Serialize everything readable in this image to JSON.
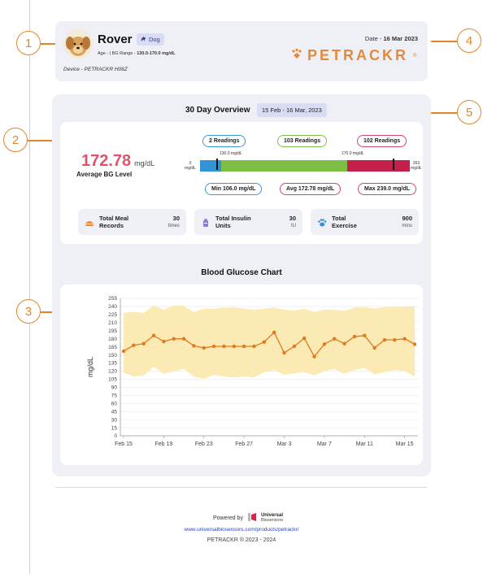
{
  "callouts": [
    "1",
    "2",
    "3",
    "4",
    "5"
  ],
  "header": {
    "pet_name": "Rover",
    "species": "Dog",
    "age_label": "Age -",
    "bg_range_label": "| BG Range -",
    "bg_range_value": "130.0-170.0 mg/dL",
    "device": "Device - PETRACKR H06Z",
    "date_label": "Date -",
    "date_value": "16 Mar 2023",
    "brand": "PETRACKR",
    "brand_reg": "®"
  },
  "overview": {
    "title": "30 Day Overview",
    "date_range": "15 Feb - 16 Mar, 2023",
    "avg_value": "172.78",
    "avg_unit": "mg/dL",
    "avg_label": "Average BG Level",
    "readings": {
      "low": "2 Readings",
      "in_range": "103 Readings",
      "high": "102 Readings"
    },
    "bar_labels": {
      "min": "0",
      "min_unit": "mg/dL",
      "low_threshold": "130.0 mg/dL",
      "high_threshold": "170.0 mg/dL",
      "max": "263",
      "max_unit": "mg/dL"
    },
    "range_fractions": {
      "low": 0.1,
      "in_range": 0.6,
      "high": 0.3
    },
    "markers_mgdl": [
      106.0,
      239.0
    ],
    "stats_pills": {
      "min": "Min 106.0 mg/dL",
      "avg": "Avg 172.78 mg/dL",
      "max": "Max 239.0 mg/dL"
    },
    "tiles": [
      {
        "label_line1": "Total Meal",
        "label_line2": "Records",
        "value": "30",
        "unit": "times",
        "icon": "meal-icon",
        "color": "#f08a3a"
      },
      {
        "label_line1": "Total Insulin",
        "label_line2": "Units",
        "value": "30",
        "unit": "IU",
        "icon": "insulin-icon",
        "color": "#8d7ae0"
      },
      {
        "label_line1": "Total",
        "label_line2": "Exercise",
        "value": "900",
        "unit": "mins",
        "icon": "paw-icon",
        "color": "#2f93d6"
      }
    ]
  },
  "colors": {
    "accent": "#e0862a",
    "avg": "#e0536a",
    "low": "#2f93d6",
    "in_range": "#7fbe44",
    "high": "#c41e4a",
    "band": "#fbeab4",
    "line": "#e07a1c"
  },
  "chart_data": {
    "type": "line",
    "title": "Blood Glucose Chart",
    "xlabel": "",
    "ylabel": "mg/dL",
    "ylim": [
      0,
      255
    ],
    "yticks": [
      0,
      15,
      30,
      45,
      60,
      75,
      90,
      105,
      120,
      135,
      150,
      165,
      180,
      195,
      210,
      225,
      240,
      255
    ],
    "x_tick_labels": [
      "Feb 15",
      "Feb 19",
      "Feb 23",
      "Feb 27",
      "Mar 3",
      "Mar 7",
      "Mar 11",
      "Mar 15"
    ],
    "x_tick_days": [
      0,
      4,
      8,
      12,
      16,
      20,
      24,
      28
    ],
    "grid": true,
    "series": [
      {
        "values": [
          157,
          168,
          171,
          186,
          175,
          180,
          180,
          167,
          163,
          166,
          166,
          166,
          166,
          166,
          174,
          192,
          154,
          166,
          181,
          147,
          170,
          180,
          171,
          184,
          186,
          163,
          178,
          178,
          180,
          170
        ]
      }
    ],
    "band_upper": [
      228,
      230,
      228,
      242,
      234,
      242,
      241,
      230,
      236,
      236,
      238,
      238,
      236,
      234,
      236,
      238,
      234,
      232,
      236,
      230,
      234,
      234,
      232,
      238,
      239,
      236,
      239,
      239,
      240,
      240
    ],
    "band_lower": [
      117,
      110,
      112,
      128,
      115,
      120,
      124,
      110,
      106,
      113,
      110,
      108,
      110,
      108,
      118,
      122,
      113,
      116,
      118,
      112,
      120,
      124,
      115,
      122,
      126,
      114,
      118,
      122,
      120,
      110
    ]
  },
  "footer": {
    "powered_by": "Powered by",
    "company_line1": "Universal",
    "company_line2": "Biosensors",
    "url": "www.universalbiosensors.com/products/petrackr/",
    "copyright": "PETRACKR ® 2023 - 2024"
  }
}
